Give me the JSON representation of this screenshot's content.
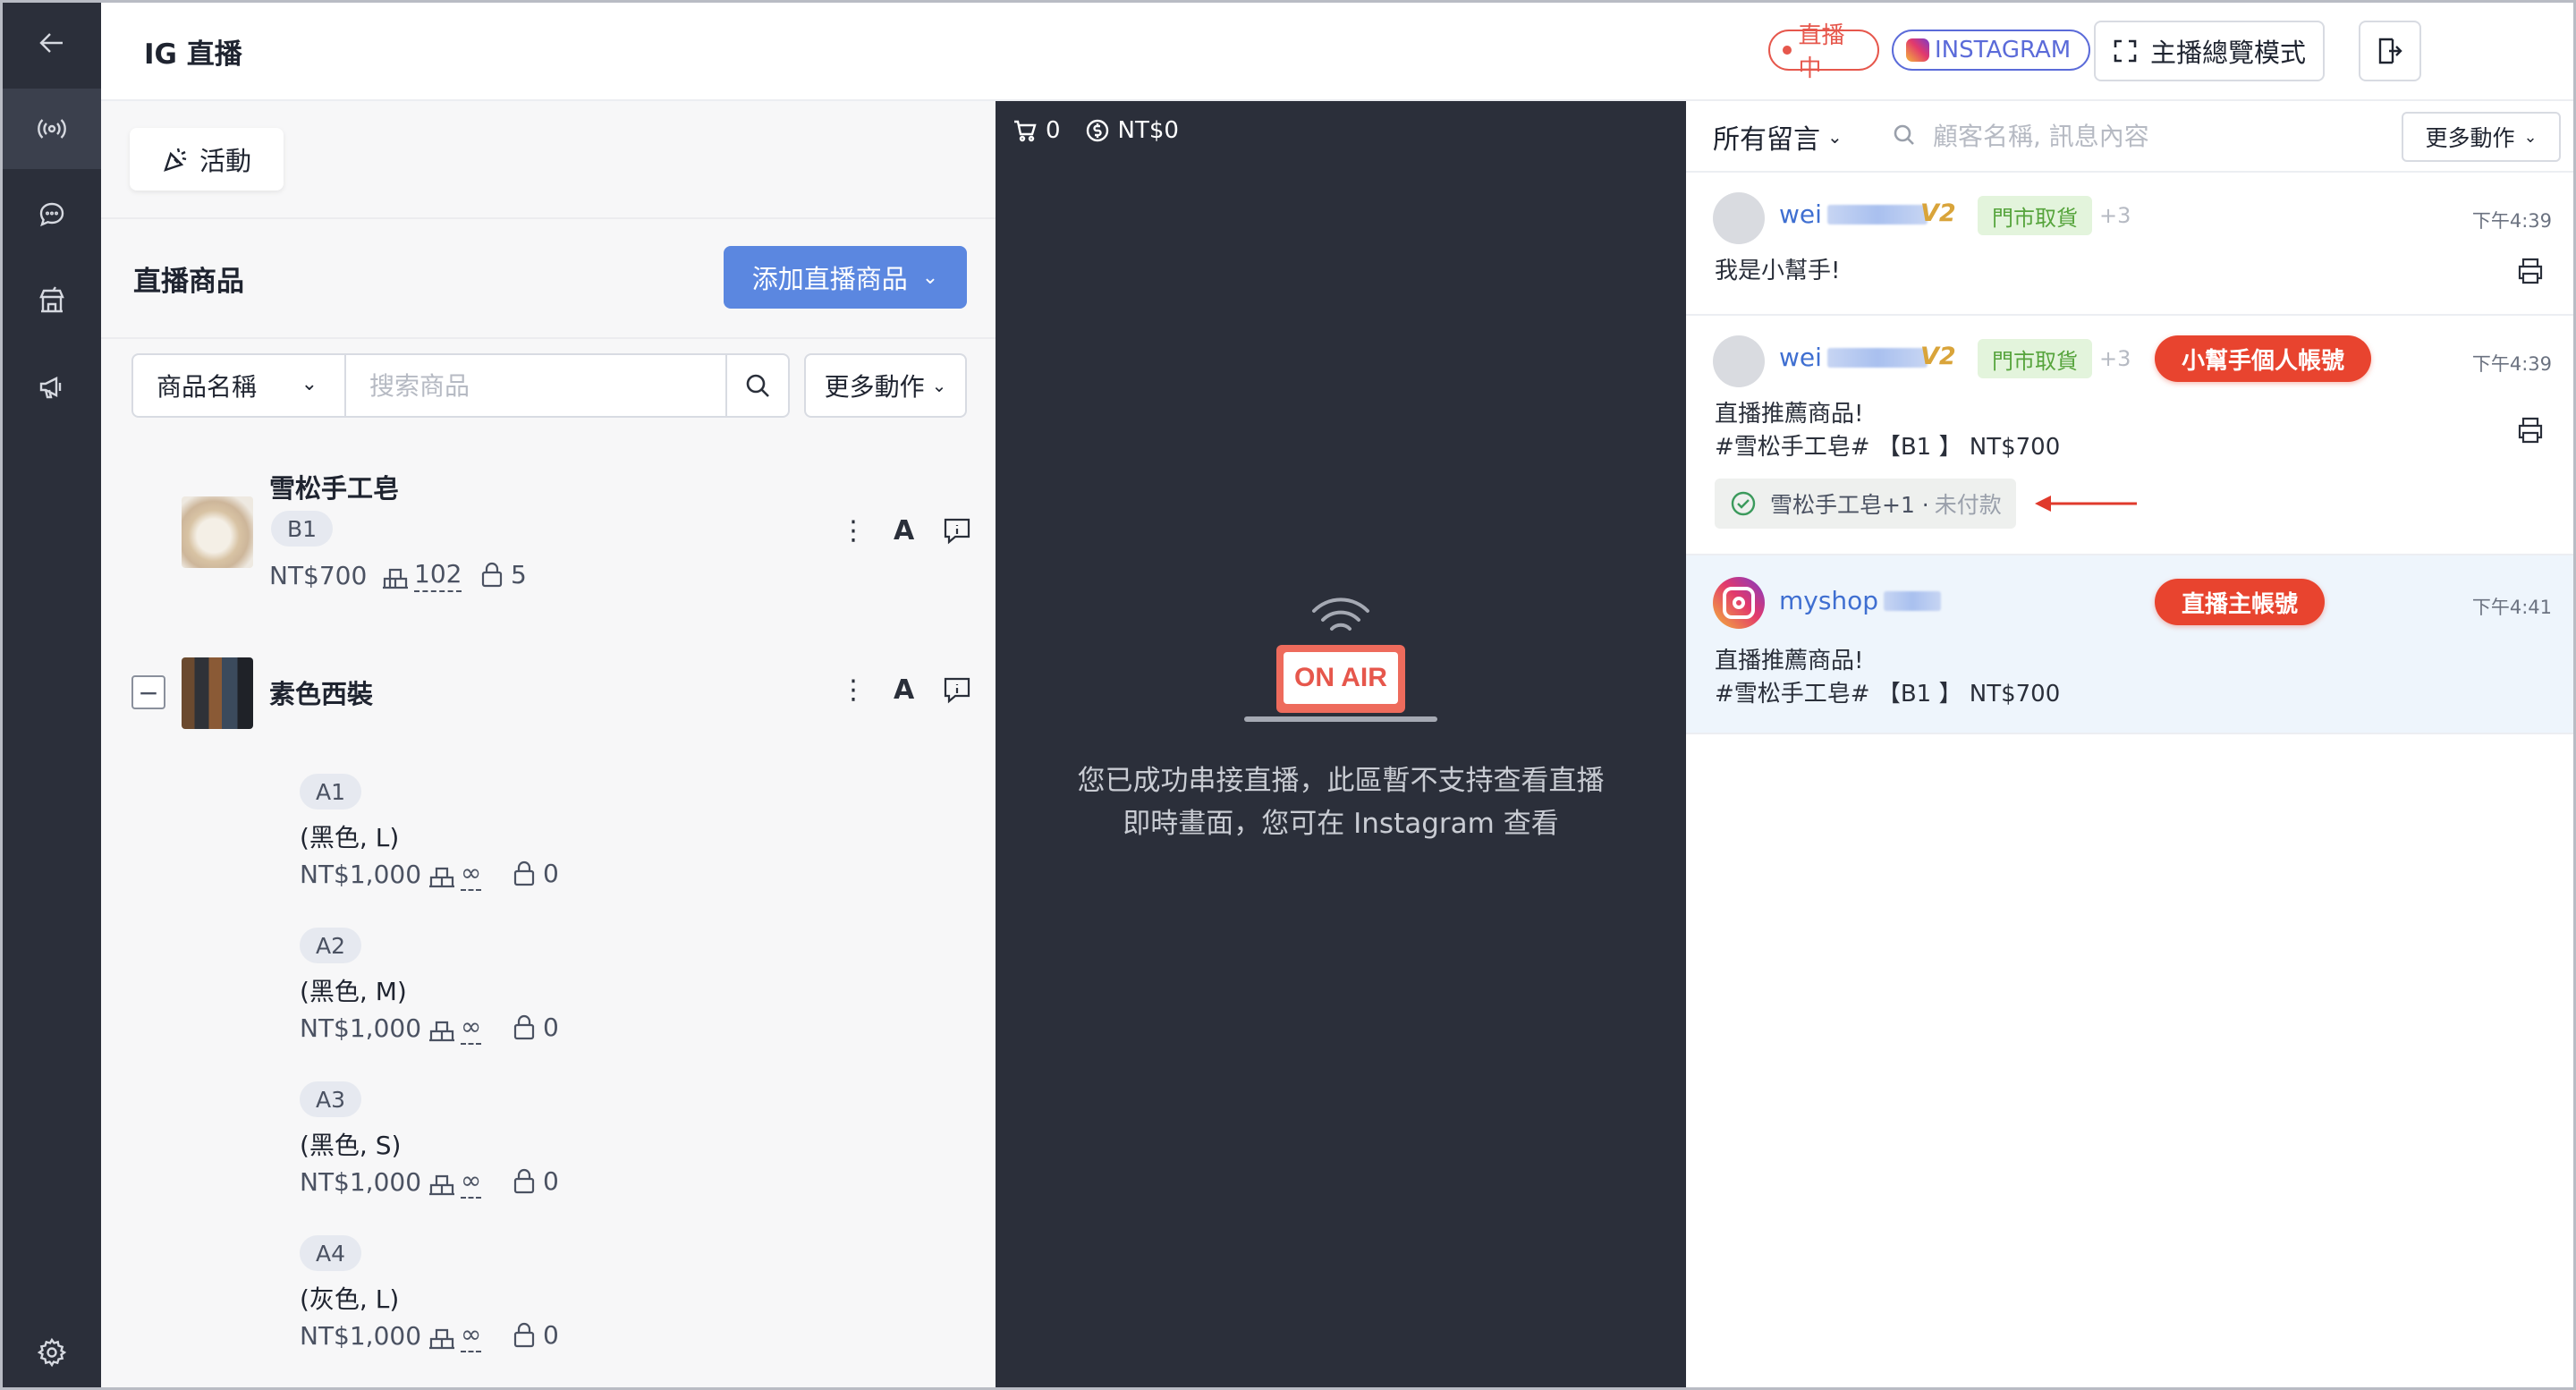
{
  "header": {
    "title": "IG 直播",
    "live_chip": "直播中",
    "platform_chip": "INSTAGRAM",
    "overview_button": "主播總覽模式"
  },
  "nav": {
    "icons": [
      "back-arrow-icon",
      "live-broadcast-icon",
      "chat-icon",
      "shop-icon",
      "megaphone-icon",
      "settings-icon"
    ]
  },
  "products": {
    "activity_button": "活動",
    "section_title": "直播商品",
    "add_button": "添加直播商品",
    "filter_select": "商品名稱",
    "search_placeholder": "搜索商品",
    "more_actions": "更多動作",
    "items": [
      {
        "name": "雪松手工皂",
        "tag": "B1",
        "price": "NT$700",
        "stock": "102",
        "locked": "5"
      },
      {
        "name": "素色西裝",
        "variants": [
          {
            "tag": "A1",
            "spec": "(黑色, L)",
            "price": "NT$1,000",
            "stock": "∞",
            "locked": "0"
          },
          {
            "tag": "A2",
            "spec": "(黑色, M)",
            "price": "NT$1,000",
            "stock": "∞",
            "locked": "0"
          },
          {
            "tag": "A3",
            "spec": "(黑色, S)",
            "price": "NT$1,000",
            "stock": "∞",
            "locked": "0"
          },
          {
            "tag": "A4",
            "spec": "(灰色, L)",
            "price": "NT$1,000",
            "stock": "∞",
            "locked": "0"
          }
        ]
      }
    ]
  },
  "stream": {
    "cart_count": "0",
    "revenue": "NT$0",
    "on_air": "ON AIR",
    "message_line1": "您已成功串接直播，此區暫不支持查看直播",
    "message_line2": "即時畫面，您可在 Instagram 查看"
  },
  "comments": {
    "filter": "所有留言",
    "search_placeholder": "顧客名稱, 訊息內容",
    "more_actions": "更多動作",
    "items": [
      {
        "user": "wei",
        "vip": "V2",
        "pickup": "門市取貨",
        "extra": "+3",
        "time": "下午4:39",
        "message": "我是小幫手!"
      },
      {
        "user": "wei",
        "vip": "V2",
        "pickup": "門市取貨",
        "extra": "+3",
        "badge": "小幫手個人帳號",
        "time": "下午4:39",
        "message_line1": "直播推薦商品!",
        "message_line2": "#雪松手工皂# 【B1 】 NT$700",
        "order": "雪松手工皂+1 ·",
        "order_status": "未付款"
      },
      {
        "user": "myshop",
        "badge": "直播主帳號",
        "time": "下午4:41",
        "message_line1": "直播推薦商品!",
        "message_line2": "#雪松手工皂# 【B1 】 NT$700"
      }
    ]
  }
}
